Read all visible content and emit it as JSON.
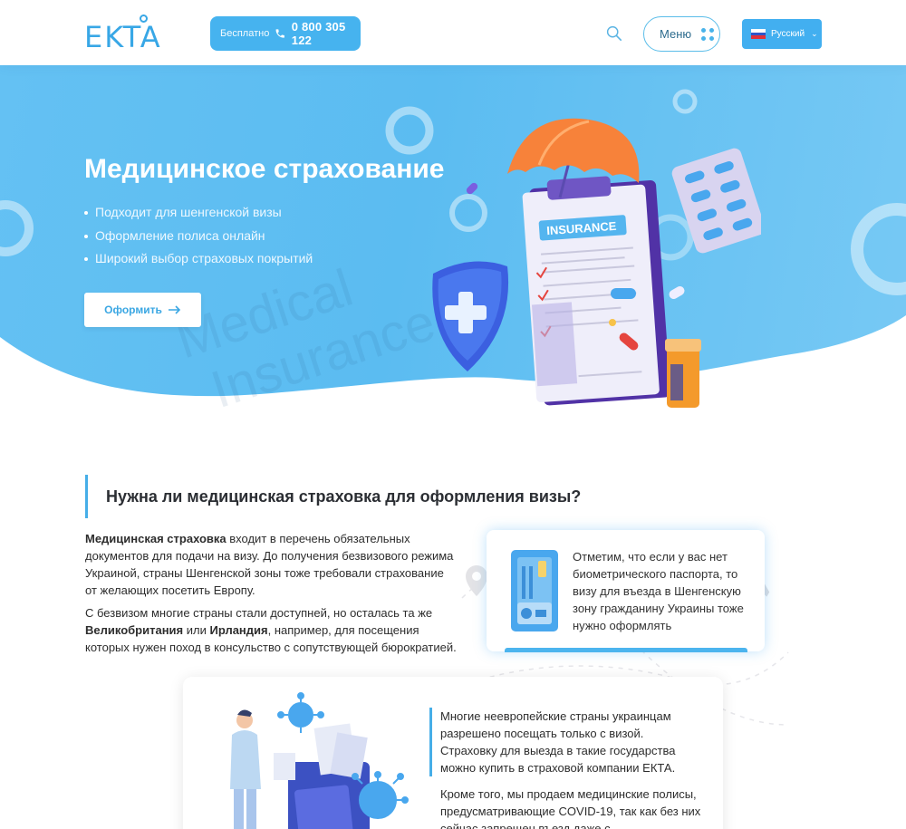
{
  "header": {
    "logo": "EKTA",
    "phone_free_label": "Бесплатно",
    "phone_number": "0 800 305 122",
    "menu_label": "Меню",
    "language_label": "Русский",
    "icons": [
      "phone-icon",
      "search-icon",
      "dots-grid-icon",
      "russia-flag-icon",
      "chevron-down-icon"
    ]
  },
  "hero": {
    "title": "Медицинское страхование",
    "bullets": [
      "Подходит для шенгенской визы",
      "Оформление полиса онлайн",
      "Широкий выбор страховых покрытий"
    ],
    "cta_label": "Оформить",
    "watermark_line1": "Medical",
    "watermark_line2": "Insurance",
    "illustration_label": "INSURANCE",
    "colors": {
      "background": "#5bbcf1",
      "umbrella": "#f7823a",
      "shield": "#3b5fe0",
      "clipboard": "#5a3fb5"
    }
  },
  "section": {
    "title": "Нужна ли медицинская страховка для оформления визы?",
    "p1_bold": "Медицинская страховка",
    "p1_rest": " входит в перечень обязательных документов для подачи на визу. До получения безвизового режима Украиной, страны Шенгенской зоны тоже требовали страхование от желающих посетить Европу.",
    "p2_start": "С безвизом многие страны стали доступней, но осталась та же ",
    "p2_bold1": "Великобритания",
    "p2_mid": " или ",
    "p2_bold2": "Ирландия",
    "p2_end": ", например, для посещения которых нужен поход в консульство с сопутствующей бюрократией.",
    "note": "Отметим, что если у вас нет биометрического паспорта, то визу для въезда в Шенгенскую зону гражданину Украины тоже нужно оформлять"
  },
  "bottom": {
    "quote": "Многие неевропейские страны украинцам разрешено посещать только с визой. Страховку для выезда в такие государства можно купить в страховой компании ЕКТА.",
    "more": "Кроме того, мы продаем медицинские полисы, предусматривающие COVID-19, так как без них сейчас запрещен въезд даже с биометрическим"
  }
}
